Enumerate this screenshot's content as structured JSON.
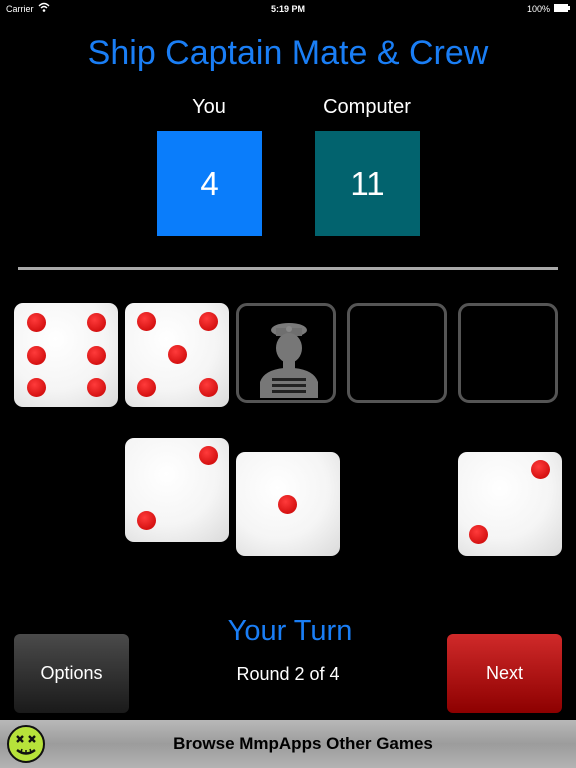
{
  "status_bar": {
    "carrier": "Carrier",
    "time": "5:19 PM",
    "battery": "100%"
  },
  "title": "Ship Captain Mate & Crew",
  "scores": {
    "you": {
      "label": "You",
      "value": "4"
    },
    "computer": {
      "label": "Computer",
      "value": "11"
    }
  },
  "kept_slots": {
    "dice": [
      6,
      5
    ],
    "crew_icon": "sailor-icon"
  },
  "rolled_dice": [
    2,
    1,
    2
  ],
  "turn_text": "Your Turn",
  "round_text": "Round 2 of 4",
  "buttons": {
    "options": "Options",
    "next": "Next"
  },
  "banner": {
    "text": "Browse MmpApps Other Games",
    "logo_icon": "mmpapps-logo-icon"
  },
  "colors": {
    "title": "#1a7ef5",
    "you_box": "#0a7dfb",
    "computer_box": "#02636e",
    "pip": "#e01010",
    "next_button": "#b00000"
  }
}
